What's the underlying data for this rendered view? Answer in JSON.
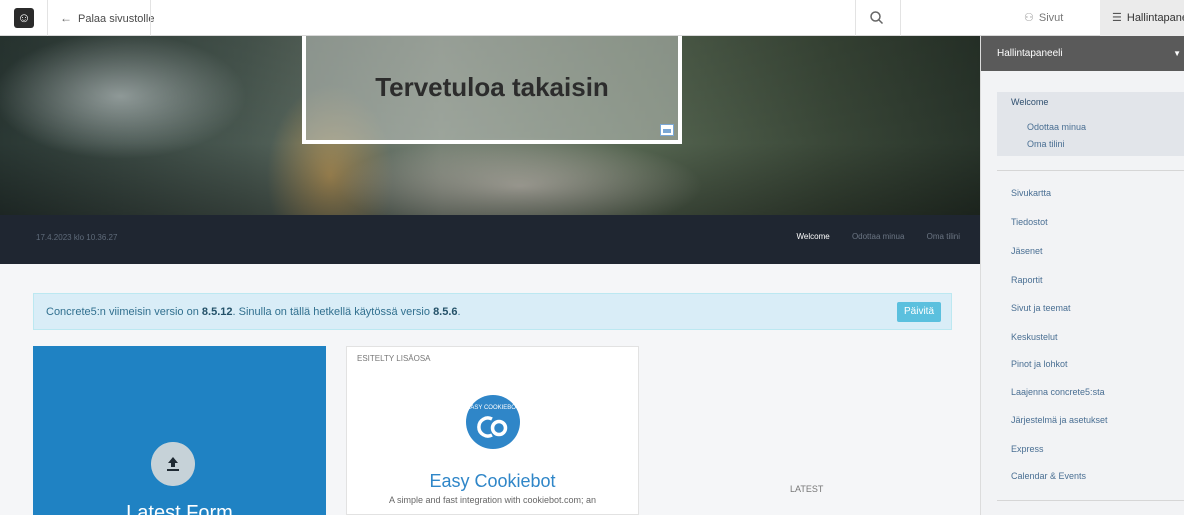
{
  "toolbar": {
    "back_label": "Palaa sivustolle",
    "pages_label": "Sivut",
    "dashboard_label": "Hallintapaneeli"
  },
  "hero": {
    "title": "Tervetuloa takaisin"
  },
  "navbar": {
    "date": "17.4.2023 klo 10.36.27",
    "links": [
      "Welcome",
      "Odottaa minua",
      "Oma tilini"
    ]
  },
  "alert": {
    "text_pre": "Concrete5:n viimeisin versio on ",
    "latest_version": "8.5.12",
    "text_mid": ". Sinulla on tällä hetkellä käytössä versio ",
    "current_version": "8.5.6",
    "text_end": ".",
    "button": "Päivitä"
  },
  "cards": {
    "latest_form_title": "Latest Form",
    "featured_label": "ESITELTY LISÄOSA",
    "addon_logo_text": "EASY COOKIEBOT",
    "addon_title": "Easy Cookiebot",
    "addon_desc": "A simple and fast integration with cookiebot.com; an",
    "latest_label": "LATEST"
  },
  "panel": {
    "title": "Hallintapaneeli",
    "welcome_items": [
      "Welcome",
      "Odottaa minua",
      "Oma tilini"
    ],
    "items": [
      "Sivukartta",
      "Tiedostot",
      "Jäsenet",
      "Raportit",
      "Sivut ja teemat",
      "Keskustelut",
      "Pinot ja lohkot",
      "Laajenna concrete5:sta",
      "Järjestelmä ja asetukset",
      "Express",
      "Calendar & Events"
    ]
  },
  "colors": {
    "accent_blue": "#1f82c3",
    "navbar_dark": "#1f2631",
    "alert_bg": "#d9edf7",
    "button_info": "#5bc0de"
  }
}
